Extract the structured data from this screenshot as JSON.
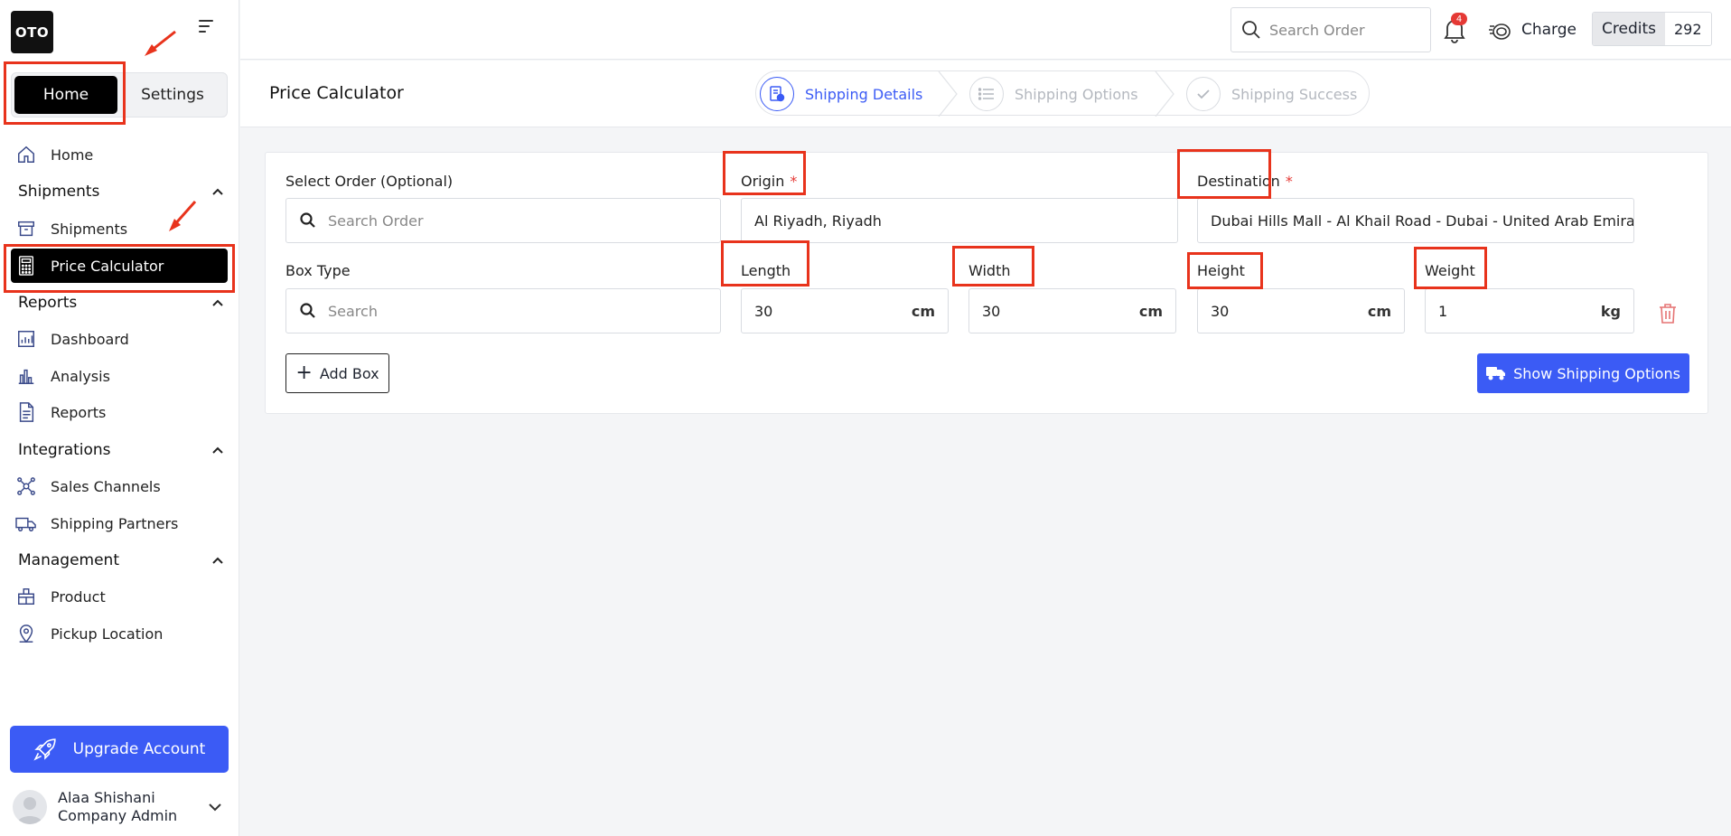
{
  "brand": {
    "logo_text": "OTO"
  },
  "sidebar": {
    "tabs": {
      "home": "Home",
      "settings": "Settings"
    },
    "items": {
      "home": "Home",
      "shipments_section": "Shipments",
      "shipments": "Shipments",
      "price_calculator": "Price Calculator",
      "reports_section": "Reports",
      "dashboard": "Dashboard",
      "analysis": "Analysis",
      "reports": "Reports",
      "integrations_section": "Integrations",
      "sales_channels": "Sales Channels",
      "shipping_partners": "Shipping Partners",
      "management_section": "Management",
      "product": "Product",
      "pickup_location": "Pickup Location"
    },
    "upgrade_label": "Upgrade Account",
    "user": {
      "name": "Alaa Shishani",
      "role": "Company Admin"
    }
  },
  "header": {
    "search_placeholder": "Search Order",
    "notification_count": "4",
    "charge_label": "Charge",
    "credits_label": "Credits",
    "credits_value": "292"
  },
  "page": {
    "title": "Price Calculator",
    "steps": [
      "Shipping Details",
      "Shipping Options",
      "Shipping Success"
    ],
    "active_step": "Shipping Details"
  },
  "form": {
    "select_order_label": "Select Order (Optional)",
    "select_order_placeholder": "Search Order",
    "origin_label": "Origin",
    "origin_value": "Al Riyadh, Riyadh",
    "destination_label": "Destination",
    "destination_value": "Dubai Hills Mall - Al Khail Road - Dubai - United Arab Emirates",
    "required_mark": "*",
    "box_type_label": "Box Type",
    "box_type_placeholder": "Search",
    "length_label": "Length",
    "length_value": "30",
    "width_label": "Width",
    "width_value": "30",
    "height_label": "Height",
    "height_value": "30",
    "weight_label": "Weight",
    "weight_value": "1",
    "unit_cm": "cm",
    "unit_kg": "kg",
    "add_box_label": "Add Box",
    "show_options_label": "Show Shipping Options"
  },
  "colors": {
    "accent": "#3b5bf5",
    "annotation_red": "#e8331c",
    "active_nav_bg": "#000000"
  }
}
